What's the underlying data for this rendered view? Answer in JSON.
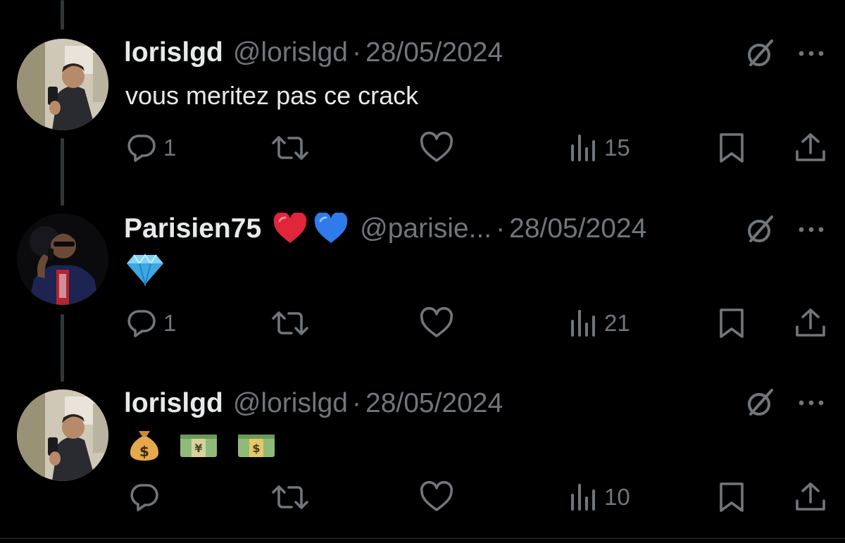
{
  "colors": {
    "background": "#000000",
    "text": "#e7e9ea",
    "muted": "#71767b",
    "thread_line": "#333639"
  },
  "tweets": [
    {
      "display_name": "lorislgd",
      "handle": "@lorislgd",
      "separator": "·",
      "date": "28/05/2024",
      "text": "vous meritez pas ce crack",
      "reply_count": "1",
      "view_count": "15"
    },
    {
      "display_name": "Parisien75",
      "name_emoji": [
        "red-heart",
        "blue-heart"
      ],
      "handle": "@parisie...",
      "separator": "·",
      "date": "28/05/2024",
      "text_emoji": [
        "gem-stone"
      ],
      "reply_count": "1",
      "view_count": "21"
    },
    {
      "display_name": "lorislgd",
      "handle": "@lorislgd",
      "separator": "·",
      "date": "28/05/2024",
      "text_emoji": [
        "money-bag",
        "yen-banknote",
        "dollar-banknote"
      ],
      "reply_count": "",
      "view_count": "10"
    }
  ],
  "icons": {
    "grok": "grok-icon",
    "more": "more-icon",
    "reply": "reply-icon",
    "retweet": "retweet-icon",
    "like": "like-icon",
    "views": "views-icon",
    "bookmark": "bookmark-icon",
    "share": "share-icon"
  }
}
